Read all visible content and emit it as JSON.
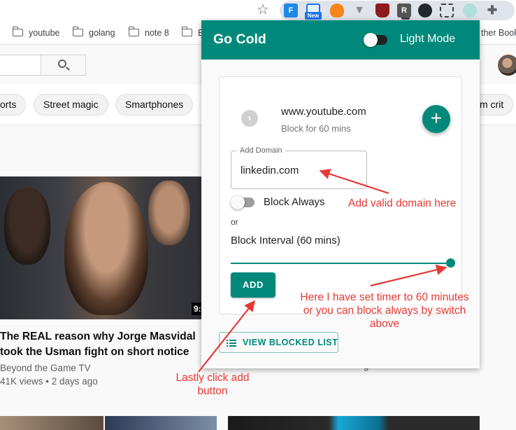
{
  "browser": {
    "extensions": [
      {
        "name": "f-ext",
        "text": "F"
      },
      {
        "name": "screenshot-ext",
        "badge": "New"
      },
      {
        "name": "metamask-ext"
      },
      {
        "name": "vivaldi-ext"
      },
      {
        "name": "ublock-ext",
        "badge": "8"
      },
      {
        "name": "r-ext",
        "text": "R"
      },
      {
        "name": "github-ext"
      },
      {
        "name": "crop-ext"
      },
      {
        "name": "gocold-ext"
      },
      {
        "name": "puzzle-ext"
      }
    ],
    "bookmarks": [
      {
        "label": "orts"
      },
      {
        "label": "youtube"
      },
      {
        "label": "golang"
      },
      {
        "label": "note 8"
      },
      {
        "label": "E"
      },
      {
        "label": "ther Book"
      }
    ]
  },
  "youtube": {
    "chips": [
      "orts",
      "Street magic",
      "Smartphones",
      "m crit"
    ],
    "video": {
      "duration": "9:",
      "title": "The REAL reason why Jorge Masvidal took the Usman fight on short notice",
      "channel": "Beyond the Game TV",
      "meta": "41K views • 2 days ago"
    },
    "side_meta": "g"
  },
  "popup": {
    "title": "Go Cold",
    "light_mode_label": "Light Mode",
    "light_mode_on": false,
    "current_site": {
      "domain": "www.youtube.com",
      "subtitle": "Block for 60 mins"
    },
    "add_domain": {
      "label": "Add Domain",
      "value": "linkedin.com"
    },
    "block_always_label": "Block Always",
    "block_always_on": false,
    "or_text": "or",
    "interval_label": "Block Interval (60 mins)",
    "interval_value": 60,
    "interval_max": 60,
    "add_button": "ADD",
    "view_button": "VIEW BLOCKED LIST",
    "accent_color": "#00897b"
  },
  "annotations": {
    "domain": "Add valid domain here",
    "timer": [
      "Here I have set timer to 60 minutes",
      "or you can block always by switch",
      "above"
    ],
    "add": [
      "Lastly click add",
      "button"
    ],
    "color": "#e53935"
  }
}
